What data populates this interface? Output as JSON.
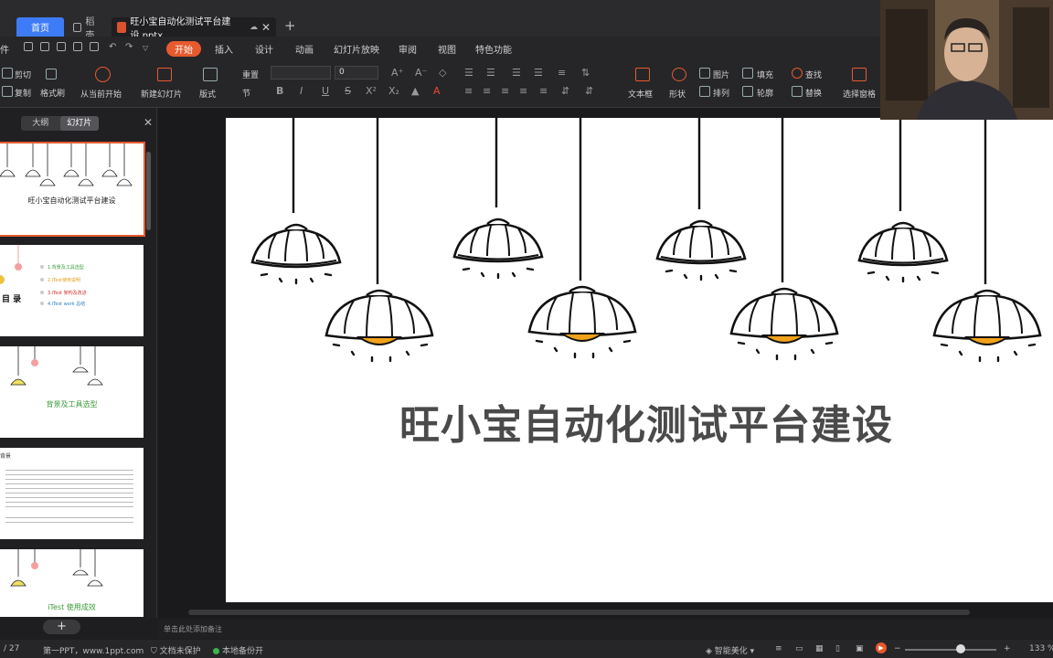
{
  "tabs": {
    "home": "首页",
    "daoke": "稻壳",
    "doc": "旺小宝自动化测试平台建设.pptx"
  },
  "menu": {
    "file": "件",
    "items": [
      "开始",
      "插入",
      "设计",
      "动画",
      "幻灯片放映",
      "审阅",
      "视图",
      "特色功能"
    ]
  },
  "ribbon": {
    "cut": "剪切",
    "copy": "复制",
    "format_painter": "格式刷",
    "play_from_current": "从当前开始",
    "new_slide": "新建幻灯片",
    "layout": "版式",
    "reset": "重置",
    "section": "节",
    "font_size": "0",
    "textbox": "文本框",
    "shape": "形状",
    "picture": "图片",
    "arrange": "排列",
    "fill": "填充",
    "outline": "轮廓",
    "find": "查找",
    "replace": "替换",
    "select_pane": "选择窗格"
  },
  "panel": {
    "outline_tab": "大纲",
    "slides_tab": "幻灯片",
    "thumbs": [
      {
        "title": "旺小宝自动化测试平台建设"
      },
      {
        "title": "目 录",
        "items": [
          "1.背景及工具选型",
          "2.iTest使用说明",
          "3.iTest 架构及改进",
          "4.iTest work 总结"
        ]
      },
      {
        "title": "背景及工具选型"
      },
      {
        "title": "背景"
      },
      {
        "title": "iTest 使用成效"
      }
    ],
    "add_label": "+"
  },
  "slide": {
    "title": "旺小宝自动化测试平台建设"
  },
  "notes": {
    "placeholder": "单击此处添加备注"
  },
  "status": {
    "page": "/ 27",
    "theme": "第一PPT，www.1ppt.com",
    "protect": "文档未保护",
    "backup": "本地备份开",
    "beautify": "智能美化",
    "zoom": "133 %"
  },
  "colors": {
    "accent": "#e65a2e",
    "home_tab": "#3d7bf7",
    "bulb": "#f0a21a"
  }
}
